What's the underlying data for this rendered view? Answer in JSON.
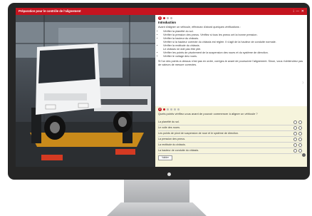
{
  "window": {
    "title": "Préparation pour le contrôle de l'alignement",
    "controls": {
      "info": "i",
      "label": "—",
      "close": "✕"
    }
  },
  "section1": {
    "number": "1",
    "title": "Introduction",
    "intro": "Avant d'aligner un véhicule, effectuez d'abord quelques vérifications :",
    "items": [
      "Vérifier la planéité du sol.",
      "Vérifier la pression des pneus. Vérifiez si tous les pneus ont la bonne pression.",
      "Vérifier la hauteur du châssis.",
      "Vérifier si la hauteur correcte du châssis est réglée. Il s'agit de la hauteur de conduite normale.",
      "Vérifier la rectitude du châssis.",
      "Le châssis ne doit pas être plié.",
      "Vérifier les points de pivotement de la suspension des roues et du système de direction.",
      "Vérifier le voilage des roues."
    ],
    "outro": "Si l'un des points ci-dessus n'est pas en ordre, corrigez-le avant de poursuivre l'alignement. Sinon, vous n'obtiendrez pas de valeurs de mesure correctes."
  },
  "section2": {
    "number": "2",
    "question": "Quels points vérifiez-vous avant de pouvoir commencer à aligner un véhicule ?",
    "options": [
      "La planéité du sol.",
      "Le voile des roues.",
      "Les points de pivot de suspension de roue et le système de direction.",
      "La pression des pneus.",
      "La rectitude du châssis.",
      "La hauteur de conduite du châssis."
    ],
    "validate_label": "Valider"
  }
}
